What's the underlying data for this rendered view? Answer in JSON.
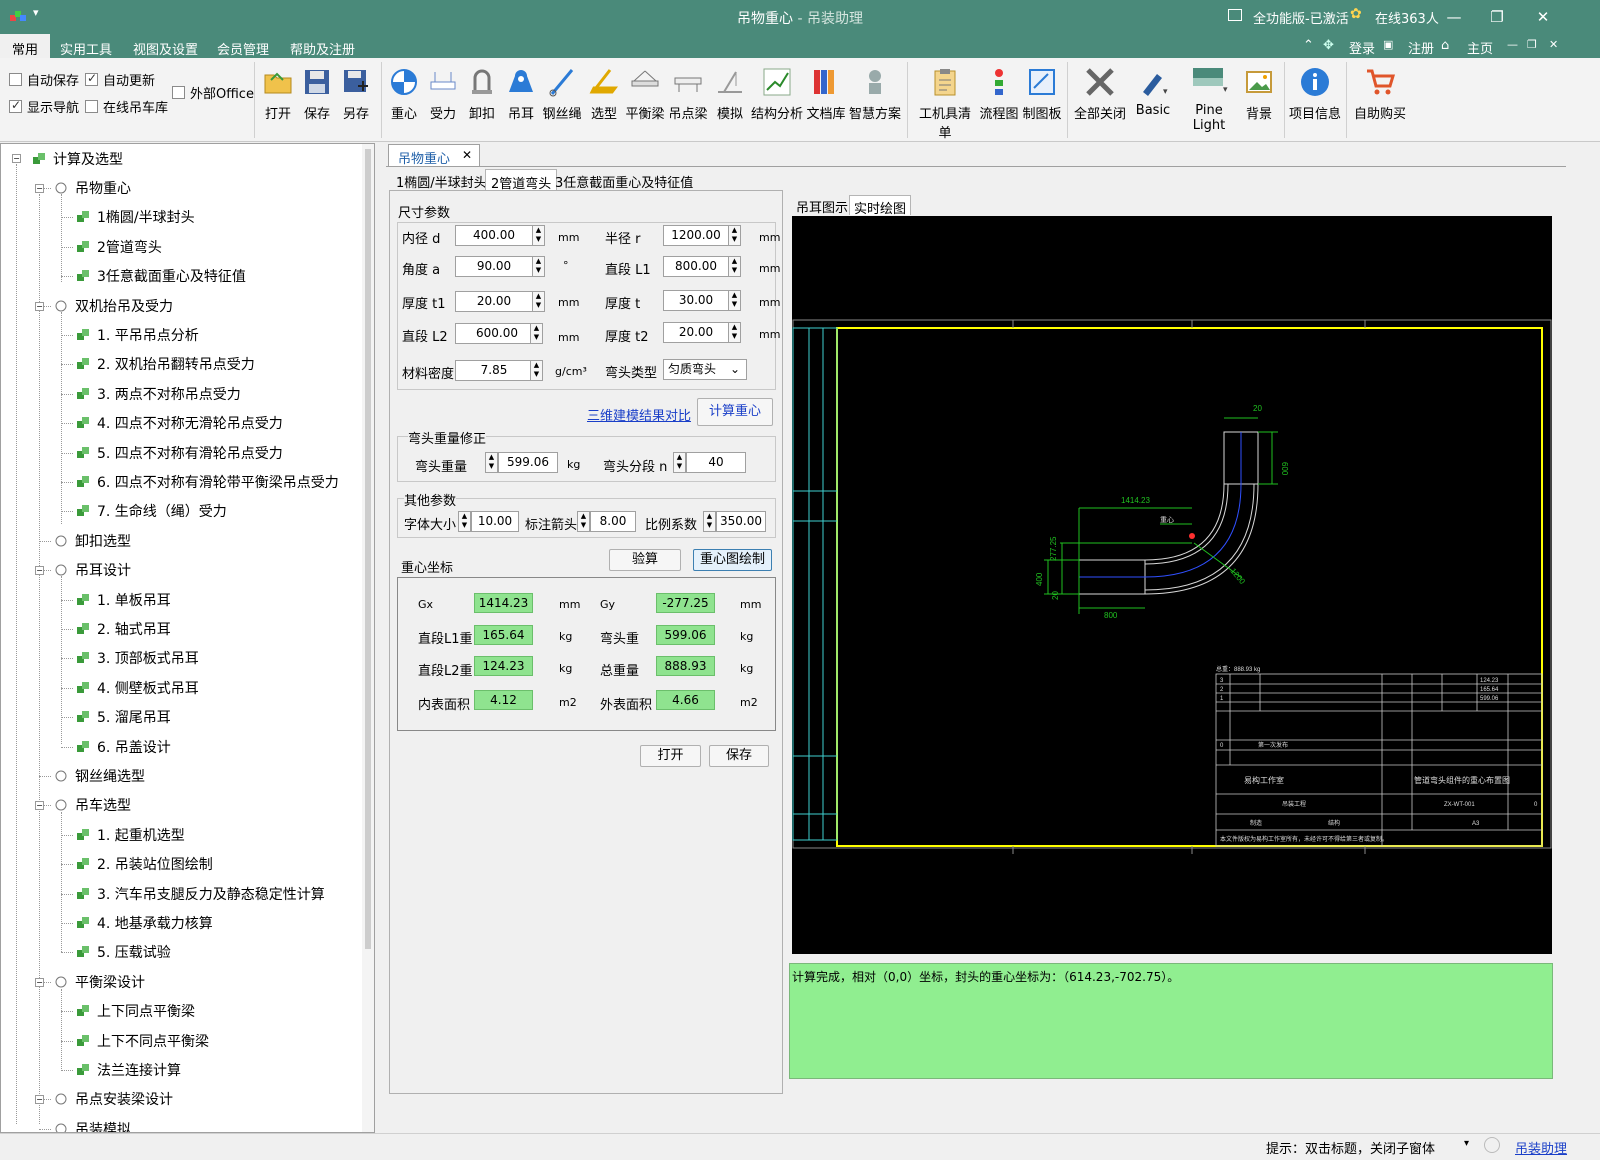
{
  "window": {
    "title": "吊物重心",
    "subtitle": " - 吊装助理",
    "status": "全功能版-已激活",
    "online": "在线363人"
  },
  "menu": {
    "items": [
      "常用",
      "实用工具",
      "视图及设置",
      "会员管理",
      "帮助及注册"
    ],
    "right": [
      "登录",
      "注册",
      "主页"
    ]
  },
  "ribbon": {
    "checks": [
      {
        "label": "自动保存",
        "checked": false
      },
      {
        "label": "自动更新",
        "checked": true
      },
      {
        "label": "外部Office",
        "checked": false
      },
      {
        "label": "显示导航",
        "checked": true
      },
      {
        "label": "在线吊车库",
        "checked": false
      }
    ],
    "buttons": [
      "打开",
      "保存",
      "另存",
      "重心",
      "受力",
      "卸扣",
      "吊耳",
      "钢丝绳",
      "选型",
      "平衡梁",
      "吊点梁",
      "模拟",
      "结构分析",
      "文档库",
      "智慧方案",
      "工机具清单",
      "流程图",
      "制图板",
      "全部关闭",
      "Basic",
      "Pine Light",
      "背景",
      "项目信息",
      "自助购买"
    ]
  },
  "tree": {
    "root": "计算及选型",
    "items": [
      {
        "label": "吊物重心",
        "level": 1
      },
      {
        "label": "1椭圆/半球封头",
        "level": 2
      },
      {
        "label": "2管道弯头",
        "level": 2
      },
      {
        "label": "3任意截面重心及特征值",
        "level": 2
      },
      {
        "label": "双机抬吊及受力",
        "level": 1
      },
      {
        "label": "1. 平吊吊点分析",
        "level": 2
      },
      {
        "label": "2. 双机抬吊翻转吊点受力",
        "level": 2
      },
      {
        "label": "3. 两点不对称吊点受力",
        "level": 2
      },
      {
        "label": "4. 四点不对称无滑轮吊点受力",
        "level": 2
      },
      {
        "label": "5. 四点不对称有滑轮吊点受力",
        "level": 2
      },
      {
        "label": "6. 四点不对称有滑轮带平衡梁吊点受力",
        "level": 2
      },
      {
        "label": "7. 生命线（绳）受力",
        "level": 2
      },
      {
        "label": "卸扣选型",
        "level": 1
      },
      {
        "label": "吊耳设计",
        "level": 1
      },
      {
        "label": "1. 单板吊耳",
        "level": 2
      },
      {
        "label": "2. 轴式吊耳",
        "level": 2
      },
      {
        "label": "3. 顶部板式吊耳",
        "level": 2
      },
      {
        "label": "4. 侧壁板式吊耳",
        "level": 2
      },
      {
        "label": "5. 溜尾吊耳",
        "level": 2
      },
      {
        "label": "6. 吊盖设计",
        "level": 2
      },
      {
        "label": "钢丝绳选型",
        "level": 1
      },
      {
        "label": "吊车选型",
        "level": 1
      },
      {
        "label": "1. 起重机选型",
        "level": 2
      },
      {
        "label": "2. 吊装站位图绘制",
        "level": 2
      },
      {
        "label": "3. 汽车吊支腿反力及静态稳定性计算",
        "level": 2
      },
      {
        "label": "4. 地基承载力核算",
        "level": 2
      },
      {
        "label": "5. 压载试验",
        "level": 2
      },
      {
        "label": "平衡梁设计",
        "level": 1
      },
      {
        "label": "上下同点平衡梁",
        "level": 2
      },
      {
        "label": "上下不同点平衡梁",
        "level": 2
      },
      {
        "label": "法兰连接计算",
        "level": 2
      },
      {
        "label": "吊点安装梁设计",
        "level": 1
      },
      {
        "label": "吊装模拟",
        "level": 1
      }
    ]
  },
  "doc": {
    "tab": "吊物重心",
    "subtabs": [
      "1椭圆/半球封头",
      "2管道弯头",
      "3任意截面重心及特征值"
    ]
  },
  "form": {
    "dim_title": "尺寸参数",
    "fields": [
      {
        "label": "内径 d",
        "value": "400.00",
        "unit": "mm"
      },
      {
        "label": "半径 r",
        "value": "1200.00",
        "unit": "mm"
      },
      {
        "label": "角度 a",
        "value": "90.00",
        "unit": "°"
      },
      {
        "label": "直段 L1",
        "value": "800.00",
        "unit": "mm"
      },
      {
        "label": "厚度 t1",
        "value": "20.00",
        "unit": "mm"
      },
      {
        "label": "厚度 t",
        "value": "30.00",
        "unit": "mm"
      },
      {
        "label": "直段 L2",
        "value": "600.00",
        "unit": "mm"
      },
      {
        "label": "厚度 t2",
        "value": "20.00",
        "unit": "mm"
      },
      {
        "label": "材料密度",
        "value": "7.85",
        "unit": "g/cm³"
      }
    ],
    "elbow_type_label": "弯头类型",
    "elbow_type": "匀质弯头",
    "compare_link": "三维建模结果对比",
    "calc_button": "计算重心",
    "correct_title": "弯头重量修正",
    "elbow_weight_label": "弯头重量",
    "elbow_weight": "599.06",
    "elbow_weight_unit": "kg",
    "segments_label": "弯头分段 n",
    "segments": "40",
    "other_title": "其他参数",
    "font_size_label": "字体大小",
    "font_size": "10.00",
    "arrow_label": "标注箭头",
    "arrow": "8.00",
    "scale_label": "比例系数",
    "scale": "350.00",
    "cg_title": "重心坐标",
    "check_button": "验算",
    "draw_button": "重心图绘制",
    "results": [
      {
        "label": "Gx",
        "value": "1414.23",
        "unit": "mm"
      },
      {
        "label": "Gy",
        "value": "-277.25",
        "unit": "mm"
      },
      {
        "label": "直段L1重",
        "value": "165.64",
        "unit": "kg"
      },
      {
        "label": "弯头重",
        "value": "599.06",
        "unit": "kg"
      },
      {
        "label": "直段L2重",
        "value": "124.23",
        "unit": "kg"
      },
      {
        "label": "总重量",
        "value": "888.93",
        "unit": "kg"
      },
      {
        "label": "内表面积",
        "value": "4.12",
        "unit": "m2"
      },
      {
        "label": "外表面积",
        "value": "4.66",
        "unit": "m2"
      }
    ],
    "open_button": "打开",
    "save_button": "保存"
  },
  "drawing": {
    "tabs": [
      "吊耳图示",
      "实时绘图"
    ],
    "dims": [
      "20",
      "600",
      "1414.23",
      "277.25",
      "400",
      "20",
      "800",
      "1200",
      "重心"
    ],
    "total_weight": "总重：888.93 kg",
    "bom_rows": [
      [
        "3",
        "124.23"
      ],
      [
        "2",
        "165.64"
      ],
      [
        "1",
        "599.06"
      ]
    ],
    "company": "易构工作室",
    "drawing_title": "管道弯头组件的重心布置图",
    "drawing_no": "ZX-WT-001",
    "project": "吊装工程",
    "stage": "制造",
    "specialty": "结构",
    "size": "A3",
    "rev": "0",
    "first_issue": "第一次发布",
    "copyright": "本文件版权为易构工作室所有，未经许可不得给第三者或复制。"
  },
  "output": "计算完成，相对（0,0）坐标，封头的重心坐标为：（614.23,-702.75）。",
  "status": {
    "hint": "提示：双击标题，关闭子窗体",
    "link": "吊装助理"
  }
}
